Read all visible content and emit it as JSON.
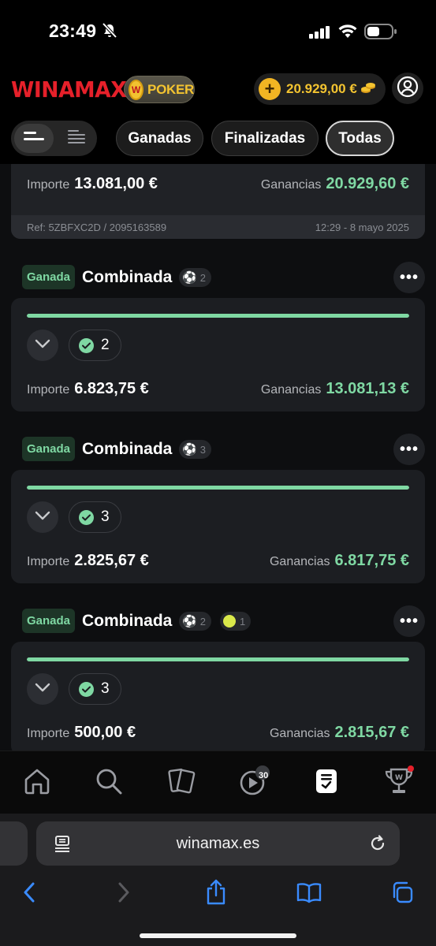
{
  "status_bar": {
    "time": "23:49"
  },
  "header": {
    "logo": "WINAMAX",
    "poker_label": "POKER",
    "poker_coin_letter": "W",
    "balance": "20.929,00 €"
  },
  "filters": {
    "chips": [
      "Ganadas",
      "Finalizadas",
      "Todas"
    ],
    "active": "Todas"
  },
  "bets": {
    "top": {
      "stake_label": "Importe",
      "stake": "13.081,00 €",
      "winnings_label": "Ganancias",
      "winnings": "20.929,60 €",
      "ref": "Ref: 5ZBFXC2D / 2095163589",
      "date": "12:29 - 8 mayo 2025"
    },
    "items": [
      {
        "status": "Ganada",
        "type": "Combinada",
        "football_count": "2",
        "won_selections": "2",
        "progress": 1.0,
        "stake_label": "Importe",
        "stake": "6.823,75 €",
        "winnings_label": "Ganancias",
        "winnings": "13.081,13 €"
      },
      {
        "status": "Ganada",
        "type": "Combinada",
        "football_count": "3",
        "won_selections": "3",
        "progress": 1.0,
        "stake_label": "Importe",
        "stake": "2.825,67 €",
        "winnings_label": "Ganancias",
        "winnings": "6.817,75 €"
      },
      {
        "status": "Ganada",
        "type": "Combinada",
        "football_count": "2",
        "tennis_count": "1",
        "won_selections": "3",
        "progress": 1.0,
        "stake_label": "Importe",
        "stake": "500,00 €",
        "winnings_label": "Ganancias",
        "winnings": "2.815,67 €"
      }
    ]
  },
  "tabbar": {
    "items": [
      "home-icon",
      "search-icon",
      "cards-icon",
      "live-icon",
      "my-bets-icon",
      "trophy-icon"
    ],
    "live_badge": "30",
    "active": "my-bets-icon"
  },
  "safari": {
    "url": "winamax.es"
  },
  "colors": {
    "brand_red": "#e6202a",
    "win_green": "#7fd8a3",
    "gold": "#f4c430"
  }
}
